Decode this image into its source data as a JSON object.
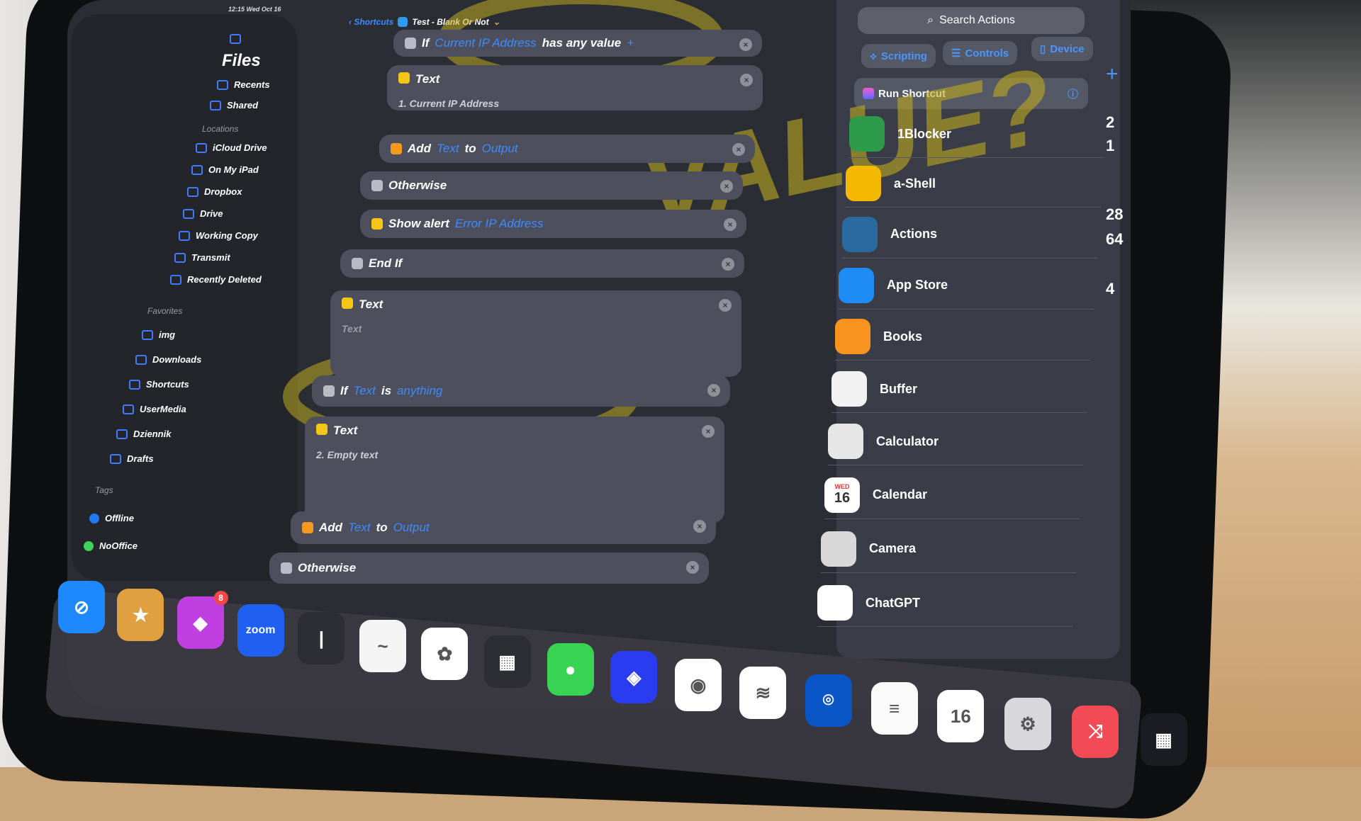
{
  "status_bar": {
    "time": "12:15",
    "date": "Wed Oct 16"
  },
  "sidebar": {
    "title": "Files",
    "top_items": [
      {
        "label": "Recents",
        "icon": "clock-icon"
      },
      {
        "label": "Shared",
        "icon": "shared-folder-icon"
      }
    ],
    "locations_label": "Locations",
    "locations": [
      {
        "label": "iCloud Drive",
        "icon": "cloud-icon"
      },
      {
        "label": "On My iPad",
        "icon": "ipad-icon"
      },
      {
        "label": "Dropbox",
        "icon": "dropbox-icon"
      },
      {
        "label": "Drive",
        "icon": "google-drive-icon"
      },
      {
        "label": "Working Copy",
        "icon": "working-copy-icon"
      },
      {
        "label": "Transmit",
        "icon": "transmit-icon"
      },
      {
        "label": "Recently Deleted",
        "icon": "trash-icon"
      }
    ],
    "favorites_label": "Favorites",
    "favorites": [
      {
        "label": "img"
      },
      {
        "label": "Downloads"
      },
      {
        "label": "Shortcuts"
      },
      {
        "label": "UserMedia"
      },
      {
        "label": "Dziennik"
      },
      {
        "label": "Drafts"
      }
    ],
    "tags_label": "Tags",
    "tags": [
      {
        "label": "Offline",
        "color": "#1e7bf5"
      },
      {
        "label": "NoOffice",
        "color": "#3ed45a"
      }
    ]
  },
  "editor": {
    "back_label": "Shortcuts",
    "shortcut_name": "Test - Blank Or Not",
    "actions": [
      {
        "parts": [
          "If",
          "Current IP Address",
          "has any value",
          "+"
        ],
        "color": "#b8bac4"
      },
      {
        "parts": [
          "Text"
        ],
        "color": "#f5c518",
        "content": "1. Current IP Address"
      },
      {
        "parts": [
          "Add",
          "Text",
          "to",
          "Output"
        ],
        "color": "#f59a1e"
      },
      {
        "parts": [
          "Otherwise"
        ],
        "color": "#b8bac4"
      },
      {
        "parts": [
          "Show alert",
          "Error IP Address"
        ],
        "color": "#f5c518"
      },
      {
        "parts": [
          "End If"
        ],
        "color": "#b8bac4"
      },
      {
        "parts": [
          "Text"
        ],
        "color": "#f5c518",
        "placeholder": "Text"
      },
      {
        "parts": [
          "If",
          "Text",
          "is",
          "anything"
        ],
        "color": "#b8bac4"
      },
      {
        "parts": [
          "Text"
        ],
        "color": "#f5c518",
        "content": "2. Empty text"
      },
      {
        "parts": [
          "Add",
          "Text",
          "to",
          "Output"
        ],
        "color": "#f59a1e"
      },
      {
        "parts": [
          "Otherwise"
        ],
        "color": "#b8bac4"
      }
    ]
  },
  "actions_panel": {
    "search_placeholder": "Search Actions",
    "categories": [
      {
        "label": "Scripting"
      },
      {
        "label": "Controls"
      },
      {
        "label": "Device"
      }
    ],
    "suggested": "Run Shortcut",
    "apps": [
      {
        "label": "1Blocker",
        "color": "#2e9b4a"
      },
      {
        "label": "a-Shell",
        "color": "#f5b800"
      },
      {
        "label": "Actions",
        "color": "#2a6a9e"
      },
      {
        "label": "App Store",
        "color": "#1f8bf5"
      },
      {
        "label": "Books",
        "color": "#f7931e"
      },
      {
        "label": "Buffer",
        "color": "#f2f2f2"
      },
      {
        "label": "Calculator",
        "color": "#e6e6e6"
      },
      {
        "label": "Calendar",
        "color": "#ffffff",
        "day": "WED",
        "date": "16"
      },
      {
        "label": "Camera",
        "color": "#d8d8d8"
      },
      {
        "label": "ChatGPT",
        "color": "#ffffff"
      }
    ]
  },
  "side_numbers": [
    "2",
    "1",
    "28",
    "64",
    "4"
  ],
  "annotation": "VALUE?",
  "dock": [
    {
      "name": "safari",
      "color": "#1e88ff",
      "glyph": "⊘"
    },
    {
      "name": "reeder",
      "color": "#e0a040",
      "glyph": "★"
    },
    {
      "name": "craft",
      "color": "#c03fe0",
      "glyph": "◆",
      "badge": "8"
    },
    {
      "name": "zoom",
      "color": "#2060f0",
      "glyph": "zoom"
    },
    {
      "name": "ia-writer",
      "color": "#2c2e34",
      "glyph": "|"
    },
    {
      "name": "freeform",
      "color": "#f4f4f4",
      "glyph": "~"
    },
    {
      "name": "photos",
      "color": "#ffffff",
      "glyph": "✿"
    },
    {
      "name": "app-folder",
      "color": "#2c2e34",
      "glyph": "▦"
    },
    {
      "name": "messages",
      "color": "#39d353",
      "glyph": "●"
    },
    {
      "name": "shortcuts",
      "color": "#2a3cf0",
      "glyph": "◈"
    },
    {
      "name": "chrome",
      "color": "#ffffff",
      "glyph": "◉"
    },
    {
      "name": "buffer",
      "color": "#ffffff",
      "glyph": "≋"
    },
    {
      "name": "1password",
      "color": "#0a55c8",
      "glyph": "⌾"
    },
    {
      "name": "notes",
      "color": "#fafafa",
      "glyph": "≡"
    },
    {
      "name": "calendar",
      "color": "#ffffff",
      "glyph": "16"
    },
    {
      "name": "settings",
      "color": "#d8d8dc",
      "glyph": "⚙"
    },
    {
      "name": "shuffle",
      "color": "#f24b55",
      "glyph": "⤨"
    },
    {
      "name": "recent-apps",
      "color": "#1c1d22",
      "glyph": "▦"
    }
  ]
}
